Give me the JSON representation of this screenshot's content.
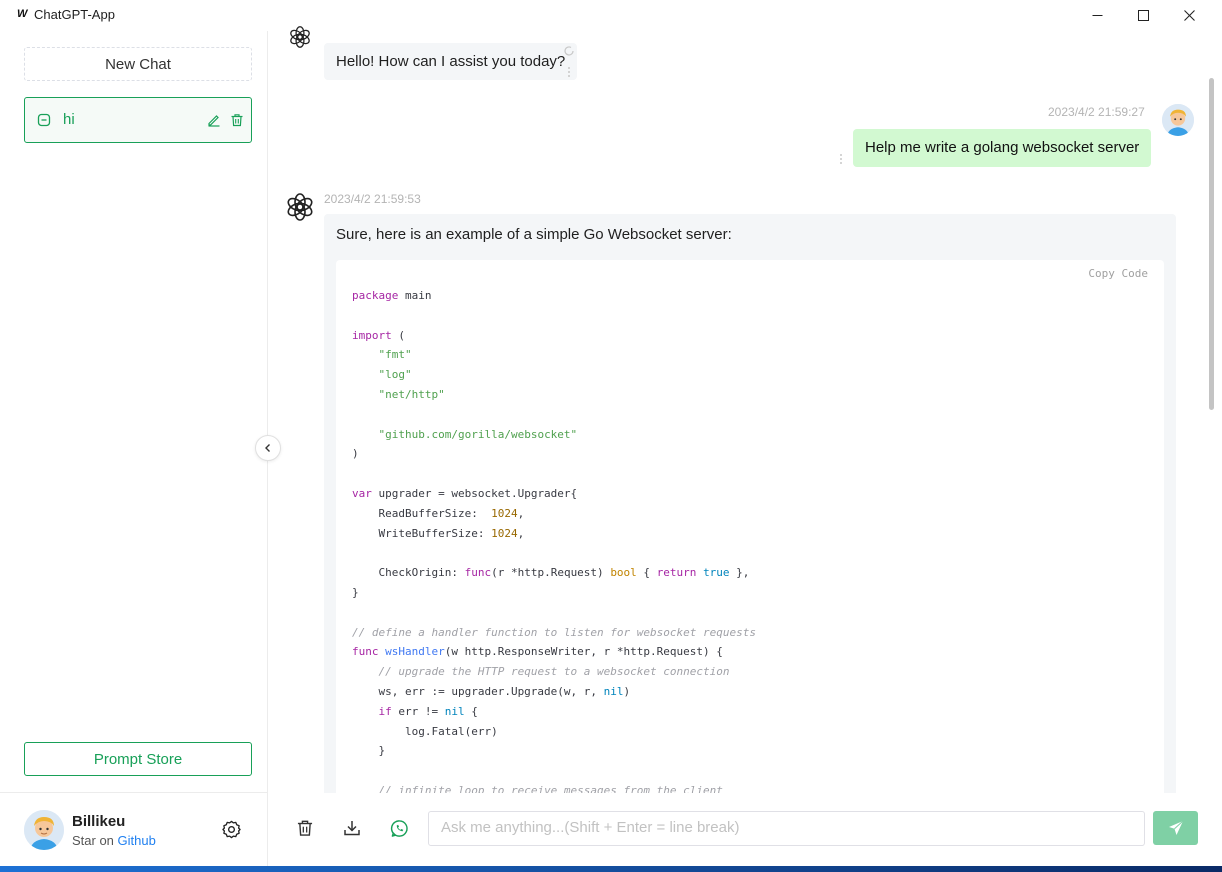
{
  "window": {
    "app_title": "ChatGPT-App",
    "app_logo": "W"
  },
  "sidebar": {
    "new_chat_label": "New Chat",
    "chats": [
      {
        "title": "hi"
      }
    ],
    "prompt_store_label": "Prompt Store",
    "user": {
      "name": "Billikeu",
      "star_prefix": "Star on",
      "star_link": "Github"
    }
  },
  "messages": [
    {
      "role": "assistant",
      "text": "Hello! How can I assist you today?"
    },
    {
      "role": "user",
      "timestamp": "2023/4/2 21:59:27",
      "text": "Help me write a golang websocket server"
    },
    {
      "role": "assistant",
      "timestamp": "2023/4/2 21:59:53",
      "text": "Sure, here is an example of a simple Go Websocket server:",
      "copy_label": "Copy Code"
    }
  ],
  "input": {
    "placeholder": "Ask me anything...(Shift + Enter = line break)"
  },
  "colors": {
    "accent": "#18a058",
    "user_bubble": "#d2f9d1",
    "assistant_bubble": "#f4f6f8",
    "send_button": "#7fd0a5"
  },
  "icons": [
    "minimize-icon",
    "maximize-icon",
    "close-icon",
    "chat-icon",
    "edit-icon",
    "trash-icon",
    "settings-icon",
    "chevron-left-icon",
    "chatgpt-logo-icon",
    "refresh-icon",
    "more-vertical-icon",
    "download-icon",
    "whatsapp-icon",
    "send-icon"
  ]
}
